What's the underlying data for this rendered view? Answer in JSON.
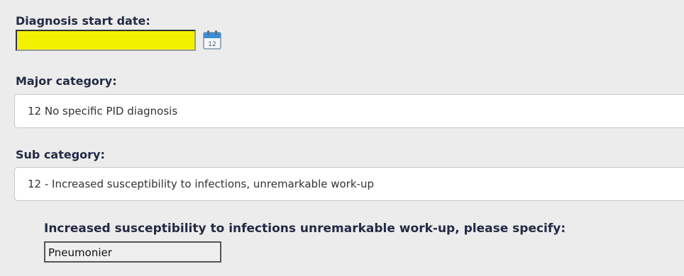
{
  "diagnosis_start_date": {
    "label": "Diagnosis start date:",
    "value": "",
    "calendar_icon": "calendar-icon",
    "calendar_icon_text": "12",
    "highlight_color": "#f2f200"
  },
  "major_category": {
    "label": "Major category:",
    "selected": "12 No specific PID diagnosis"
  },
  "sub_category": {
    "label": "Sub category:",
    "selected": "12 - Increased susceptibility to infections, unremarkable work-up"
  },
  "specify": {
    "label": "Increased susceptibility to infections unremarkable work-up, please specify:",
    "value": "Pneumonier"
  }
}
